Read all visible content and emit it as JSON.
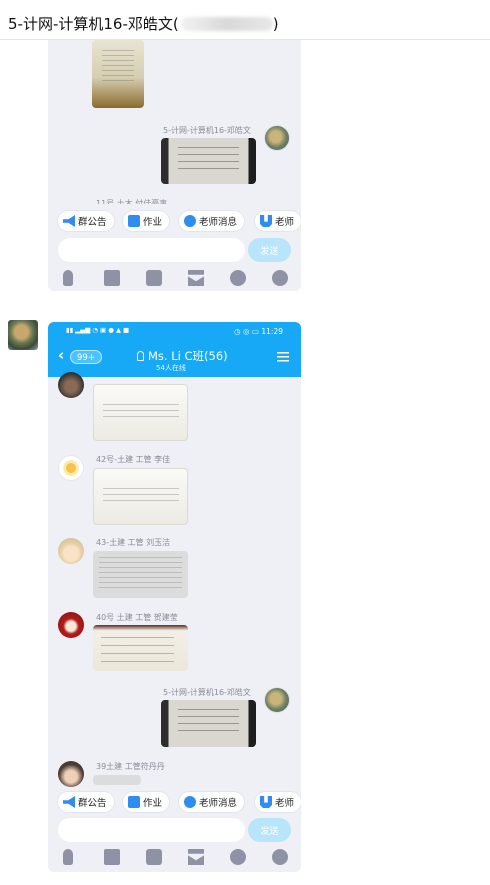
{
  "header": {
    "title": "5-计网-计算机16-邓皓文(",
    "title_suffix": ")"
  },
  "shot1": {
    "self_name": "5-计网-计算机16-邓皓文",
    "partial_name": "11号 土木 付佳豪事"
  },
  "chips": [
    "群公告",
    "作业",
    "老师消息",
    "老师"
  ],
  "send_label": "发送",
  "shot2": {
    "status_time": "11:29",
    "back_badge": "99+",
    "group_name": "Ms. Li C班(56)",
    "online": "54人在线",
    "messages": [
      {
        "name": "42号-土建 工管 李佳"
      },
      {
        "name": "43-土建 工管 刘玉洁"
      },
      {
        "name": "40号 土建 工管 贺建莹"
      },
      {
        "name": "5-计网-计算机16-邓皓文"
      },
      {
        "name": "39土建 工管符丹丹"
      }
    ]
  },
  "icons": [
    "mic-icon",
    "image-icon",
    "camera-icon",
    "red-packet-icon",
    "emoji-icon",
    "plus-icon"
  ],
  "colors": {
    "accent": "#17a9f5",
    "send_disabled": "#b9e5fb",
    "chat_bg": "#eef0f6"
  }
}
